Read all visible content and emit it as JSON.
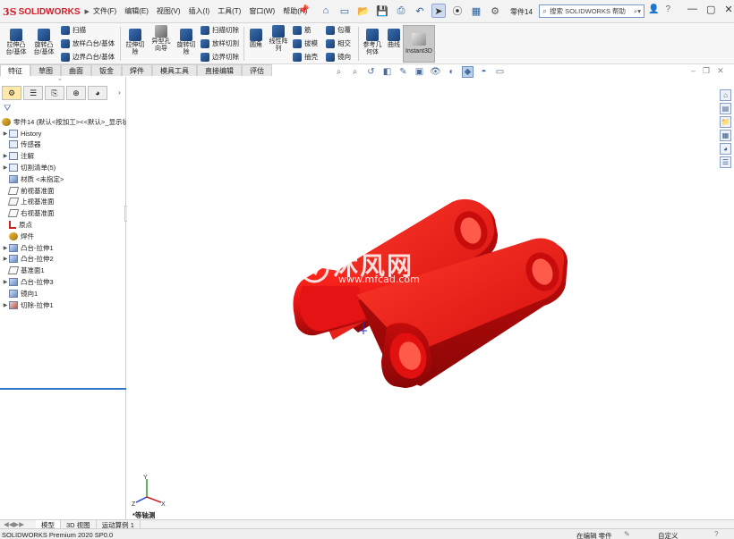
{
  "app": {
    "logo_ds": "3S",
    "logo_text": "SOLIDWORKS",
    "doc_title": "零件14",
    "help_placeholder": "搜索 SOLIDWORKS 帮助"
  },
  "menu": [
    "文件(F)",
    "编辑(E)",
    "视图(V)",
    "插入(I)",
    "工具(T)",
    "窗口(W)",
    "帮助(H)"
  ],
  "ribbon": {
    "extrude_boss": "拉伸凸\n台/基体",
    "revolve_boss": "旋转凸\n台/基体",
    "sweep": "扫描",
    "loft": "放样凸台/基体",
    "boundary": "边界凸台/基体",
    "extrude_cut": "拉伸切\n除",
    "hole_wizard": "异型孔\n向导",
    "revolve_cut": "旋转切\n除",
    "swept_cut": "扫描切除",
    "lofted_cut": "放样切割",
    "boundary_cut": "边界切除",
    "fillet": "圆角",
    "linear_pattern": "线性阵\n列",
    "rib": "筋",
    "draft": "拔模",
    "shell": "抽壳",
    "wrap": "包覆",
    "intersect": "相交",
    "mirror": "镜向",
    "ref_geometry": "参考几\n何体",
    "curves": "曲线",
    "instant3d": "Instant3D"
  },
  "tabs": [
    "特征",
    "草图",
    "曲面",
    "钣金",
    "焊件",
    "模具工具",
    "直接编辑",
    "评估"
  ],
  "tree": {
    "root": "零件14 (默认<按加工><<默认>_显示状",
    "items": [
      {
        "label": "History",
        "icon": "folder",
        "arrow": true
      },
      {
        "label": "传感器",
        "icon": "folder",
        "arrow": false
      },
      {
        "label": "注解",
        "icon": "folder",
        "arrow": true
      },
      {
        "label": "切割清单(5)",
        "icon": "folder",
        "arrow": true
      },
      {
        "label": "材质 <未指定>",
        "icon": "material",
        "arrow": false
      },
      {
        "label": "前视基准面",
        "icon": "plane",
        "arrow": false
      },
      {
        "label": "上视基准面",
        "icon": "plane",
        "arrow": false
      },
      {
        "label": "右视基准面",
        "icon": "plane",
        "arrow": false
      },
      {
        "label": "原点",
        "icon": "origin",
        "arrow": false
      },
      {
        "label": "焊件",
        "icon": "weld",
        "arrow": false
      },
      {
        "label": "凸台-拉伸1",
        "icon": "boss",
        "arrow": true
      },
      {
        "label": "凸台-拉伸2",
        "icon": "boss",
        "arrow": true
      },
      {
        "label": "基准面1",
        "icon": "plane",
        "arrow": false
      },
      {
        "label": "凸台-拉伸3",
        "icon": "boss",
        "arrow": true
      },
      {
        "label": "镜向1",
        "icon": "boss",
        "arrow": false
      },
      {
        "label": "切除-拉伸1",
        "icon": "cut",
        "arrow": true
      }
    ]
  },
  "graphics": {
    "view_label": "*等轴测",
    "watermark_text": "沐风网",
    "watermark_url": "www.mfcad.com",
    "model_color": "#e81515"
  },
  "bottom_tabs": [
    "模型",
    "3D 视图",
    "运动算例 1"
  ],
  "status": {
    "product": "SOLIDWORKS Premium 2020 SP0.0",
    "editing": "在编辑 零件",
    "units": "自定义"
  }
}
